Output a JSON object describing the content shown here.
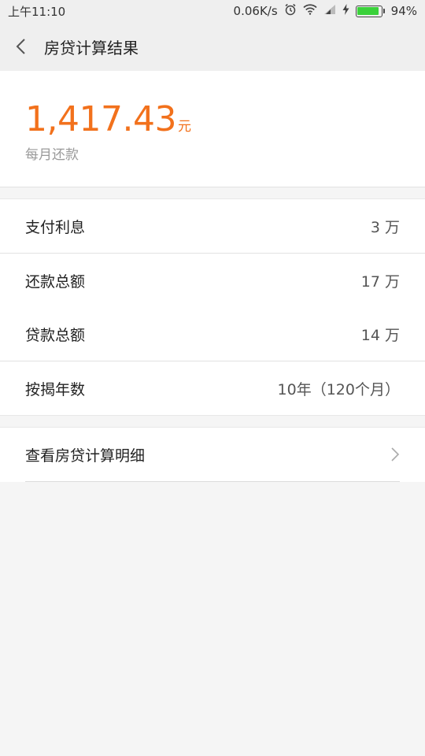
{
  "status_bar": {
    "time": "上午11:10",
    "network_speed": "0.06K/s",
    "battery_percent": "94%",
    "icons": [
      "alarm-icon",
      "wifi-icon",
      "signal-icon",
      "charging-icon",
      "battery-icon"
    ]
  },
  "header": {
    "title": "房贷计算结果",
    "back_icon": "chevron-left-icon"
  },
  "summary": {
    "amount": "1,417.43",
    "unit": "元",
    "label": "每月还款"
  },
  "stats": {
    "interest": {
      "label": "支付利息",
      "value": "3 万"
    },
    "total_repayment": {
      "label": "还款总额",
      "value": "17 万"
    },
    "loan_total": {
      "label": "贷款总额",
      "value": "14 万"
    },
    "years": {
      "label": "按揭年数",
      "value": "10年（120个月）"
    }
  },
  "detail_link": {
    "label": "查看房贷计算明细",
    "icon": "chevron-right-icon"
  },
  "colors": {
    "accent": "#f2711c",
    "background": "#f5f5f5",
    "card": "#ffffff"
  }
}
